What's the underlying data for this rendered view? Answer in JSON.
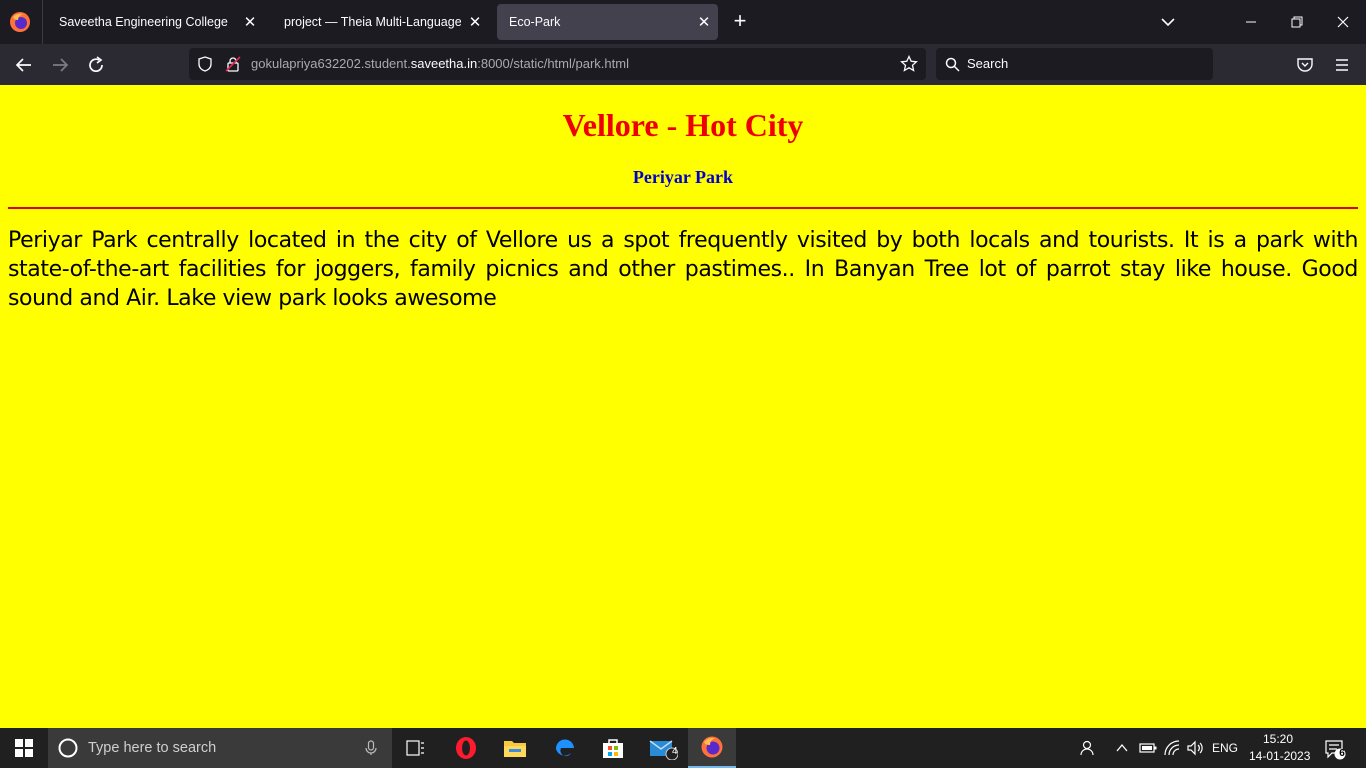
{
  "browser": {
    "tabs": [
      {
        "label": "Saveetha Engineering College",
        "active": false
      },
      {
        "label": "project — Theia Multi-Language Ex",
        "active": false
      },
      {
        "label": "Eco-Park",
        "active": true
      }
    ],
    "url_prefix": "gokulapriya632202.student.",
    "url_domain": "saveetha.in",
    "url_suffix": ":8000/static/html/park.html",
    "search_placeholder": "Search"
  },
  "page": {
    "title": "Vellore - Hot City",
    "subtitle": "Periyar Park",
    "paragraph": "Periyar Park centrally located in the city of Vellore us a spot frequently visited by both locals and tourists. It is a park with state-of-the-art facilities for joggers, family picnics and other pastimes.. In Banyan Tree lot of parrot stay like house. Good sound and Air. Lake view park looks awesome",
    "colors": {
      "background": "#ffff00",
      "title": "#ee0000",
      "subtitle": "#0000cc",
      "rule": "#dd0000"
    }
  },
  "taskbar": {
    "search_placeholder": "Type here to search",
    "mail_badge": "4",
    "language": "ENG",
    "time": "15:20",
    "date": "14-01-2023",
    "notification_count": "6"
  }
}
